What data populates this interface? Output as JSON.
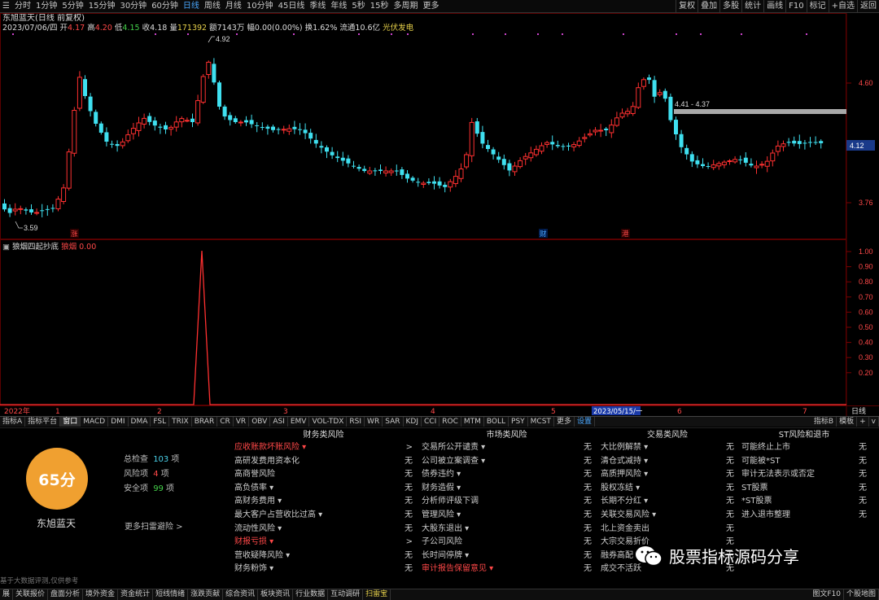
{
  "toolbar": {
    "periods": [
      "分时",
      "1分钟",
      "5分钟",
      "15分钟",
      "30分钟",
      "60分钟",
      "日线",
      "周线",
      "月线",
      "10分钟",
      "45日线",
      "季线",
      "年线",
      "5秒",
      "15秒",
      "多周期",
      "更多"
    ],
    "active_period": "日线",
    "right_buttons": [
      "复权",
      "叠加",
      "多股",
      "统计",
      "画线",
      "F10",
      "标记",
      "+自选",
      "返回"
    ]
  },
  "quote": {
    "title": "东旭蓝天(日线 前复权)",
    "date": "2023/07/06/四",
    "open_label": "开",
    "open": "4.17",
    "high_label": "高",
    "high": "4.20",
    "low_label": "低",
    "low": "4.15",
    "close_label": "收",
    "close": "4.18",
    "vol_label": "量",
    "vol": "171392",
    "amount_label": "额",
    "amount": "7143万",
    "change_label": "幅",
    "change": "0.00(0.00%)",
    "turnover_label": "换",
    "turnover": "1.62%",
    "float_label": "流通",
    "float": "10.6亿",
    "sector": "光伏发电"
  },
  "price_axis": {
    "ticks": [
      "4.60",
      "3.76"
    ],
    "current": "4.12",
    "annotations": {
      "high": "4.92",
      "low": "3.59",
      "range": "4.41 - 4.37"
    }
  },
  "markers": {
    "zhang": "涨",
    "cai": "财",
    "gang": "港"
  },
  "indicator": {
    "name": "狼烟四起抄底",
    "label": "狼烟",
    "value": "0.00",
    "ticks": [
      "1.00",
      "0.90",
      "0.80",
      "0.70",
      "0.60",
      "0.50",
      "0.40",
      "0.30",
      "0.20"
    ]
  },
  "time_axis": {
    "labels": [
      "2022年",
      "1",
      "2",
      "3",
      "4",
      "5",
      "6",
      "7"
    ],
    "selected_date": "2023/05/15/一",
    "right_label": "日线"
  },
  "indicator_tabs": {
    "items": [
      "指标A",
      "指标平台",
      "窗口",
      "MACD",
      "DMI",
      "DMA",
      "FSL",
      "TRIX",
      "BRAR",
      "CR",
      "VR",
      "OBV",
      "ASI",
      "EMV",
      "VOL-TDX",
      "RSI",
      "WR",
      "SAR",
      "KDJ",
      "CCI",
      "ROC",
      "MTM",
      "BOLL",
      "PSY",
      "MCST",
      "更多",
      "设置"
    ],
    "right": [
      "指标B",
      "模板",
      "+",
      "v"
    ]
  },
  "risk": {
    "score": "65分",
    "company": "东旭蓝天",
    "total_label": "总检查",
    "total": "103",
    "unit": "项",
    "risk_label": "风险项",
    "risk_count": "4",
    "safe_label": "安全项",
    "safe": "99",
    "more": "更多扫雷避险 >",
    "columns": [
      {
        "title": "财务类风险",
        "rows": [
          {
            "name": "应收账款坏账风险 ▾",
            "status": ">",
            "hot": true
          },
          {
            "name": "高研发费用资本化",
            "status": "无"
          },
          {
            "name": "高商誉风险",
            "status": "无"
          },
          {
            "name": "高负债率 ▾",
            "status": "无"
          },
          {
            "name": "高财务费用 ▾",
            "status": "无"
          },
          {
            "name": "最大客户占营收比过高 ▾",
            "status": "无"
          },
          {
            "name": "流动性风险 ▾",
            "status": "无"
          },
          {
            "name": "财报亏损 ▾",
            "status": ">",
            "hot": true
          },
          {
            "name": "营收疑降风险 ▾",
            "status": "无"
          },
          {
            "name": "财务粉饰 ▾",
            "status": "无"
          }
        ]
      },
      {
        "title": "市场类风险",
        "rows": [
          {
            "name": "交易所公开谴责 ▾",
            "status": "无"
          },
          {
            "name": "公司被立案调查 ▾",
            "status": "无"
          },
          {
            "name": "债券违约 ▾",
            "status": "无"
          },
          {
            "name": "财务造假 ▾",
            "status": "无"
          },
          {
            "name": "分析师评级下调",
            "status": "无"
          },
          {
            "name": "管理风险 ▾",
            "status": "无"
          },
          {
            "name": "大股东退出 ▾",
            "status": "无"
          },
          {
            "name": "子公司风险",
            "status": "无"
          },
          {
            "name": "长时间停牌 ▾",
            "status": "无"
          },
          {
            "name": "审计报告保留意见 ▾",
            "status": "无",
            "hot": true
          }
        ]
      },
      {
        "title": "交易类风险",
        "rows": [
          {
            "name": "大比例解禁 ▾",
            "status": "无"
          },
          {
            "name": "清仓式减持 ▾",
            "status": "无"
          },
          {
            "name": "高质押风险 ▾",
            "status": "无"
          },
          {
            "name": "股权冻结 ▾",
            "status": "无"
          },
          {
            "name": "长期不分红 ▾",
            "status": "无"
          },
          {
            "name": "关联交易风险 ▾",
            "status": "无"
          },
          {
            "name": "北上资金卖出",
            "status": "无"
          },
          {
            "name": "大宗交易折价",
            "status": "无"
          },
          {
            "name": "融券高配",
            "status": "无"
          },
          {
            "name": "成交不活跃",
            "status": "无"
          }
        ]
      },
      {
        "title": "ST风险和退市",
        "rows": [
          {
            "name": "可能终止上市",
            "status": "无"
          },
          {
            "name": "可能被*ST",
            "status": "无"
          },
          {
            "name": "审计无法表示或否定",
            "status": "无"
          },
          {
            "name": "ST股票",
            "status": "无"
          },
          {
            "name": "*ST股票",
            "status": "无"
          },
          {
            "name": "进入退市整理",
            "status": "无"
          }
        ]
      }
    ]
  },
  "disclaimer": "基于大数据评测,仅供参考",
  "bottom_bar": {
    "items": [
      "展",
      "关联报价",
      "盘面分析",
      "境外资金",
      "资金统计",
      "短线情绪",
      "涨跌贡献",
      "综合资讯",
      "板块资讯",
      "行业数据",
      "互动调研",
      "扫雷宝"
    ],
    "active": "扫雷宝",
    "right": [
      "图文F10",
      "个股地图"
    ]
  },
  "watermark": "股票指标源码分享",
  "colors": {
    "up": "#ff3030",
    "down": "#3fe0f0",
    "bg": "#000000",
    "grid": "#3a0000",
    "accent": "#f0a030"
  }
}
